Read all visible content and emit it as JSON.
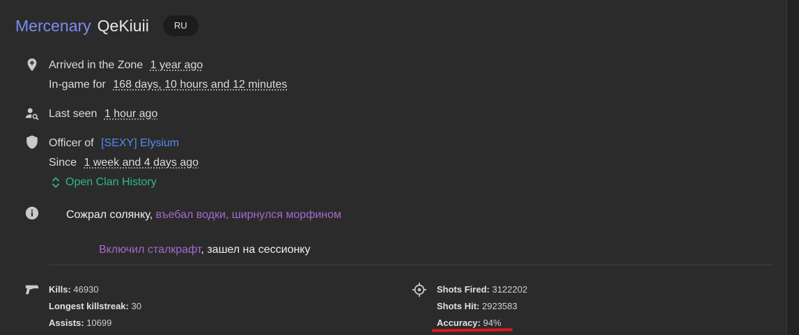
{
  "profile": {
    "rank": "Mercenary",
    "username": "QeKiuii",
    "region": "RU"
  },
  "arrival": {
    "label": "Arrived in the Zone",
    "value": "1 year ago",
    "ingame_label": "In-game for",
    "ingame_value": "168 days, 10 hours and 12 minutes"
  },
  "seen": {
    "label": "Last seen",
    "value": "1 hour ago"
  },
  "clan": {
    "role_label": "Officer of",
    "name": "[SEXY] Elysium",
    "since_label": "Since",
    "since_value": "1 week and 4 days ago",
    "history_link": "Open Clan History"
  },
  "bio": {
    "line1_a": "Сожрал солянку, ",
    "line1_b": "въебал водки, ",
    "line1_c": "ширнулся морфином",
    "line2_a": "Включил сталкрафт",
    "line2_b": ", зашел на сессионку"
  },
  "stats": {
    "kills_label": "Kills:",
    "kills": "46930",
    "killstreak_label": "Longest killstreak:",
    "killstreak": "30",
    "assists_label": "Assists:",
    "assists": "10699",
    "shots_fired_label": "Shots Fired:",
    "shots_fired": "3122202",
    "shots_hit_label": "Shots Hit:",
    "shots_hit": "2923583",
    "accuracy_label": "Accuracy:",
    "accuracy": "94%"
  },
  "icons": {
    "arrival": "location-add-icon",
    "seen": "person-search-icon",
    "clan": "shield-icon",
    "bio": "info-icon",
    "combat": "pistol-icon",
    "shooting": "crosshair-icon",
    "history": "expand-icon"
  },
  "colors": {
    "rank": "#7b8cf2",
    "clan_link": "#4f8ef0",
    "history_link": "#2fb88c",
    "bio_purple": "#a56ad0",
    "highlight_underline": "#e01818"
  }
}
